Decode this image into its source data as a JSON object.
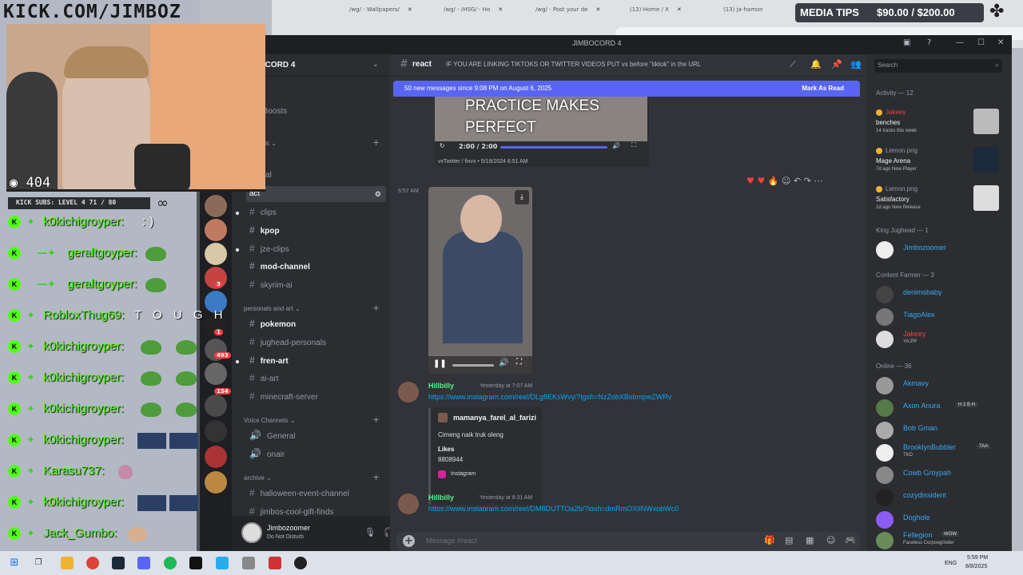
{
  "browser": {
    "tabs": [
      "/wg/ - Wallpapers/",
      "/wg/ - /HSG/ - Ho",
      "/wg/ - Post your de",
      "(13) Home / X",
      "(13) ja-hamon"
    ]
  },
  "stream": {
    "banner": "KICK.COM/JIMBOZ",
    "viewers": "404",
    "kick_subs": "KICK SUBS: LEVEL 4  71 / 80",
    "media_tips_label": "MEDIA TIPS",
    "media_tips_amount": "$90.00 / $200.00",
    "chat": [
      {
        "user": "k0kichigroyper:",
        "text": ":)"
      },
      {
        "user": "geraltgoyper:",
        "text": ""
      },
      {
        "user": "geraltgoyper:",
        "text": ""
      },
      {
        "user": "RobloxThug69:",
        "text": "T O U G H"
      },
      {
        "user": "k0kichigroyper:",
        "text": ""
      },
      {
        "user": "k0kichigroyper:",
        "text": ""
      },
      {
        "user": "k0kichigroyper:",
        "text": ""
      },
      {
        "user": "k0kichigroyper:",
        "text": ""
      },
      {
        "user": "Karasu737:",
        "text": ""
      },
      {
        "user": "k0kichigroyper:",
        "text": ""
      },
      {
        "user": "Jack_Gumbo:",
        "text": ""
      }
    ]
  },
  "discord": {
    "window_title": "JIMBOCORD 4",
    "guild_name": "JIMBOCORD 4",
    "channels_partial": [
      "nts",
      "ver Boosts",
      "channels",
      "s",
      "eneral",
      "act"
    ],
    "channels": {
      "clips": "clips",
      "kpop": "kpop",
      "jze_clips": "jze-clips",
      "mod_channel": "mod-channel",
      "skyrim_ai": "skyrim-ai",
      "cat_personals": "personals and art",
      "pokemon": "pokemon",
      "jughead_personals": "jughead-personals",
      "fren_art": "fren-art",
      "ai_art": "ai-art",
      "minecraft_server": "minecraft-server",
      "cat_voice": "Voice Channels",
      "general_voice": "General",
      "onair": "onair",
      "cat_archive": "archive",
      "halloween": "halloween-event-channel",
      "gift_finds": "jimbos-cool-gift-finds"
    },
    "server_badges": [
      "3",
      "1",
      "493",
      "154"
    ],
    "user": {
      "name": "Jimbozoomer",
      "status": "Do Not Disturb"
    },
    "channel": {
      "name": "react",
      "topic": "IF YOU ARE LINKING TIKTOKS OR TWITTER VIDEOS PUT vx before \"tiktok\" in the URL"
    },
    "new_messages": {
      "label": "50 new messages since 9:08 PM on August 6, 2025",
      "action": "Mark As Read"
    },
    "media1": {
      "overlay_text": "PRACTICE MAKES PERFECT",
      "time": "2:00 / 2:00",
      "source": "vxTwitter / fixvx • 5/19/2024 6:51 AM"
    },
    "video2_time": "6:57 AM",
    "messages": [
      {
        "author": "Hillbilly",
        "time": "Yesterday at 7:07 AM",
        "link": "https://www.instagram.com/reel/DLgfIEKsWvy/?igsh=NzZobXBsbmpwZWRv",
        "embed": {
          "author": "mamanya_farel_al_farizi",
          "description": "Cimeng naik truk oleng",
          "field_name": "Likes",
          "field_value": "8808944",
          "footer": "Instagram"
        }
      },
      {
        "author": "Hillbilly",
        "time": "Yesterday at 8:31 AM",
        "link": "https://www.instagram.com/reel/DM8DUTTOa2b/?igsh=dmRmOXlINWxpbWc0"
      }
    ],
    "composer_placeholder": "Message #react",
    "members": {
      "search_placeholder": "Search",
      "activity_header": "Activity — 12",
      "activities": [
        {
          "name": "Jakeey",
          "game": "benches",
          "info": "14 tracks this week"
        },
        {
          "name": "Lemon.png",
          "game": "Mage Arena",
          "info": "7d ago  New Player"
        },
        {
          "name": "Lemon.png",
          "game": "Satisfactory",
          "info": "1d ago  New Release"
        }
      ],
      "king_header": "King Jughead — 1",
      "king": [
        {
          "name": "Jimbozoomer"
        }
      ],
      "farmer_header": "Content Farmer — 3",
      "farmers": [
        {
          "name": "denimsbaby",
          "sub": ""
        },
        {
          "name": "TiagoAlex",
          "sub": ""
        },
        {
          "name": "Jakeey",
          "sub": "YA;PP"
        }
      ],
      "online_header": "Online — 36",
      "online": [
        {
          "name": "Akmavy",
          "sub": "",
          "tag": ""
        },
        {
          "name": "Axon Anura",
          "sub": "",
          "tag": "H 2 B H"
        },
        {
          "name": "Bob Gman",
          "sub": "",
          "tag": ""
        },
        {
          "name": "BrooklynBubbler",
          "sub": "TKD",
          "tag": "TAA"
        },
        {
          "name": "Cowb Groypah",
          "sub": "",
          "tag": ""
        },
        {
          "name": "cozydissident",
          "sub": "",
          "tag": ""
        },
        {
          "name": "Doghole",
          "sub": "",
          "tag": ""
        },
        {
          "name": "Fellegion",
          "sub": "Faceless Corpsegrinder",
          "tag": "WOW"
        }
      ]
    }
  },
  "taskbar": {
    "lang": "ENG",
    "time": "5:59 PM",
    "date": "8/8/2025"
  },
  "colors": {
    "discord_bg": "#313338",
    "blurple": "#5865f2",
    "kick_green": "#53fc18",
    "link": "#00a8fc"
  }
}
